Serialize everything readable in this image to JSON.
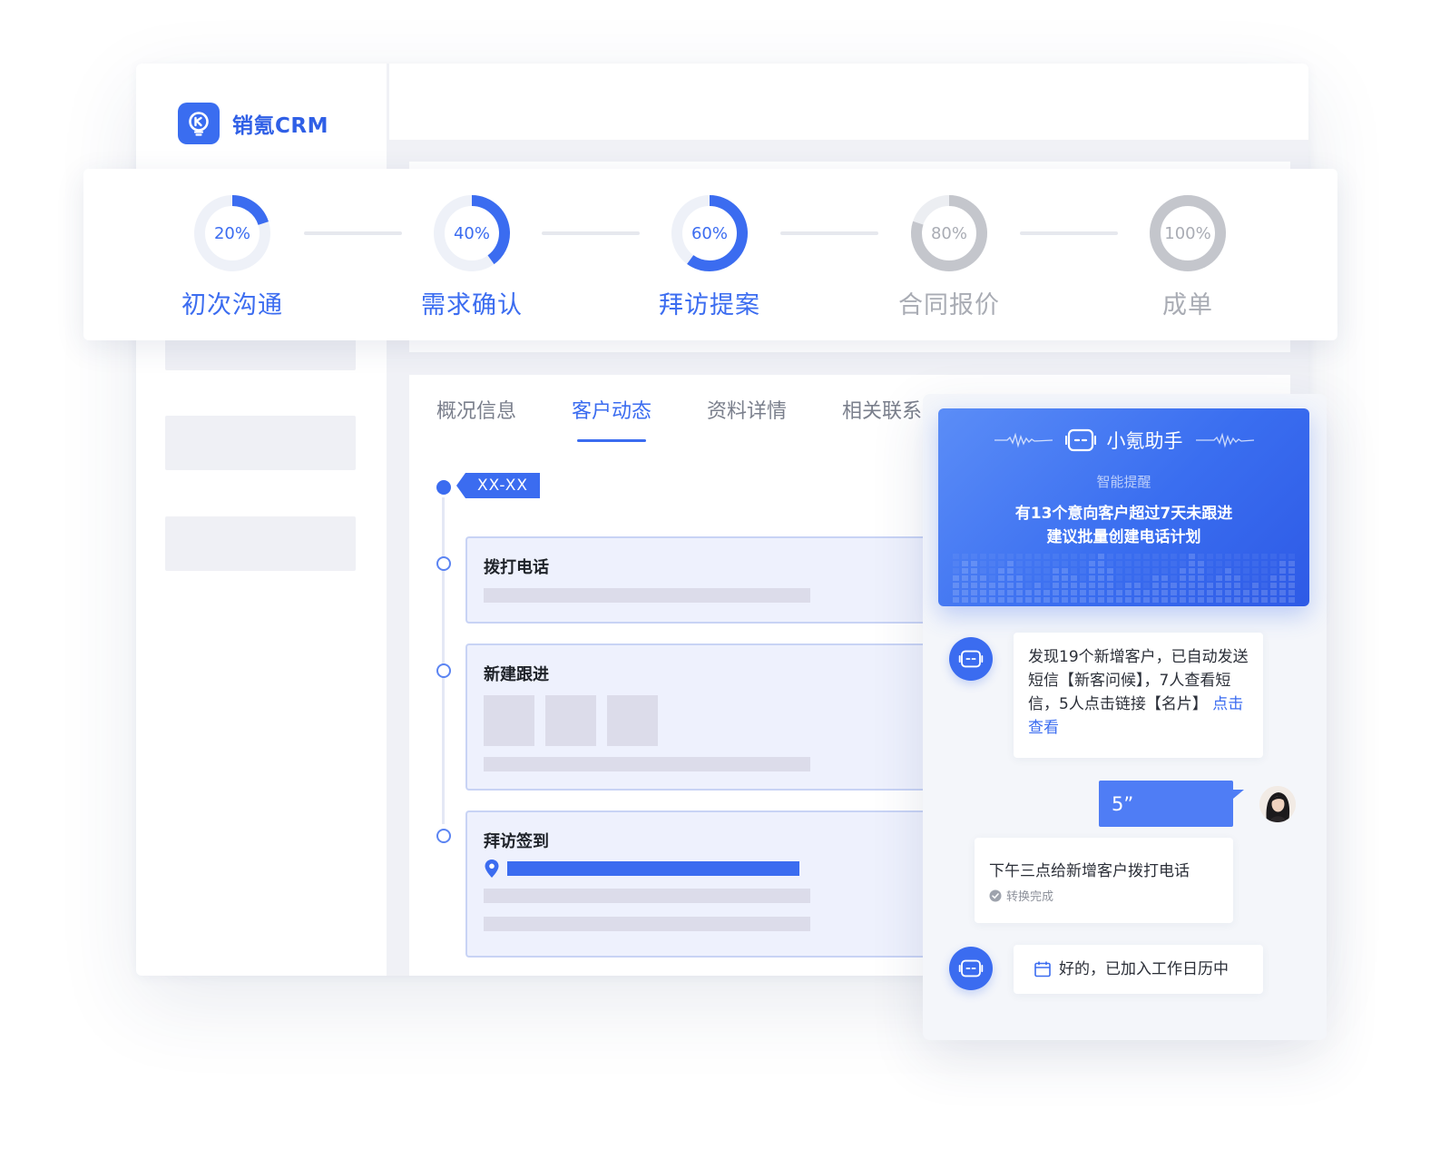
{
  "app": {
    "name": "销氪CRM"
  },
  "stages": [
    {
      "pct_label": "20%",
      "progress": 0.2,
      "label": "初次沟通",
      "state": "done"
    },
    {
      "pct_label": "40%",
      "progress": 0.4,
      "label": "需求确认",
      "state": "done"
    },
    {
      "pct_label": "60%",
      "progress": 0.6,
      "label": "拜访提案",
      "state": "current"
    },
    {
      "pct_label": "80%",
      "progress": 0.8,
      "label": "合同报价",
      "state": "pending"
    },
    {
      "pct_label": "100%",
      "progress": 1.0,
      "label": "成单",
      "state": "pending"
    }
  ],
  "tabs": [
    "概况信息",
    "客户动态",
    "资料详情",
    "相关联系"
  ],
  "active_tab": 1,
  "timeline": {
    "date_tag": "XX-XX",
    "events": [
      {
        "title": "拨打电话"
      },
      {
        "title": "新建跟进"
      },
      {
        "title": "拜访签到"
      }
    ]
  },
  "assistant": {
    "title": "小氪助手",
    "subtitle": "智能提醒",
    "line1": "有13个意向客户超过7天未跟进",
    "line2": "建议批量创建电话计划",
    "msg1_text": "发现19个新增客户，已自动发送短信【新客问候】，7人查看短信，5人点击链接【名片】",
    "msg1_link": "点击查看",
    "voice_duration": "5”",
    "transcript": "下午三点给新增客户拨打电话",
    "transcript_status": "转换完成",
    "reply": "好的，已加入工作日历中"
  },
  "colors": {
    "accent": "#3b6cf0",
    "pending": "#c4c6cc",
    "pending_text": "#a9acb4"
  }
}
